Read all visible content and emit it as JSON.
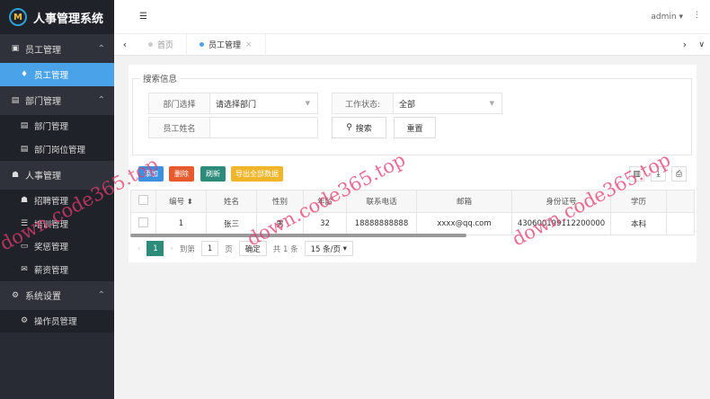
{
  "app": {
    "title": "人事管理系统",
    "logo_text": "M"
  },
  "sidebar": {
    "groups": [
      {
        "label": "员工管理",
        "icon": "user-card-icon",
        "items": [
          {
            "label": "员工管理",
            "icon": "user-icon",
            "active": true
          }
        ]
      },
      {
        "label": "部门管理",
        "icon": "id-card-icon",
        "items": [
          {
            "label": "部门管理",
            "icon": "id-card-icon"
          },
          {
            "label": "部门岗位管理",
            "icon": "id-card-icon"
          }
        ]
      },
      {
        "label": "人事管理",
        "icon": "users-icon",
        "items": [
          {
            "label": "招聘管理",
            "icon": "user-add-icon"
          },
          {
            "label": "培训管理",
            "icon": "list-icon"
          },
          {
            "label": "奖惩管理",
            "icon": "monitor-icon"
          },
          {
            "label": "薪资管理",
            "icon": "mail-icon"
          }
        ]
      },
      {
        "label": "系统设置",
        "icon": "gears-icon",
        "items": [
          {
            "label": "操作员管理",
            "icon": "gears-icon"
          }
        ]
      }
    ]
  },
  "header": {
    "user": "admin",
    "menu_icon": "menu-fold-icon"
  },
  "tabs": [
    {
      "label": "首页"
    },
    {
      "label": "员工管理",
      "active": true
    }
  ],
  "search": {
    "legend": "搜索信息",
    "dept_label": "部门选择",
    "dept_value": "请选择部门",
    "status_label": "工作状态:",
    "status_value": "全部",
    "name_label": "员工姓名",
    "name_value": "",
    "search_btn": "搜索",
    "reset_btn": "重置"
  },
  "toolbar": {
    "add": "添加",
    "delete": "删除",
    "refresh": "刷新",
    "export": "导出全部数据"
  },
  "table": {
    "headers": [
      "编号",
      "姓名",
      "性别",
      "年龄",
      "联系电话",
      "邮箱",
      "身份证号",
      "学历"
    ],
    "rows": [
      [
        "1",
        "张三",
        "男",
        "32",
        "18888888888",
        "xxxx@qq.com",
        "430600199112200000",
        "本科"
      ]
    ]
  },
  "pager": {
    "page": "1",
    "goto_label": "到第",
    "goto_value": "1",
    "page_unit": "页",
    "confirm": "确定",
    "total": "共 1 条",
    "page_size": "15 条/页"
  },
  "watermark": "down.code365.top"
}
